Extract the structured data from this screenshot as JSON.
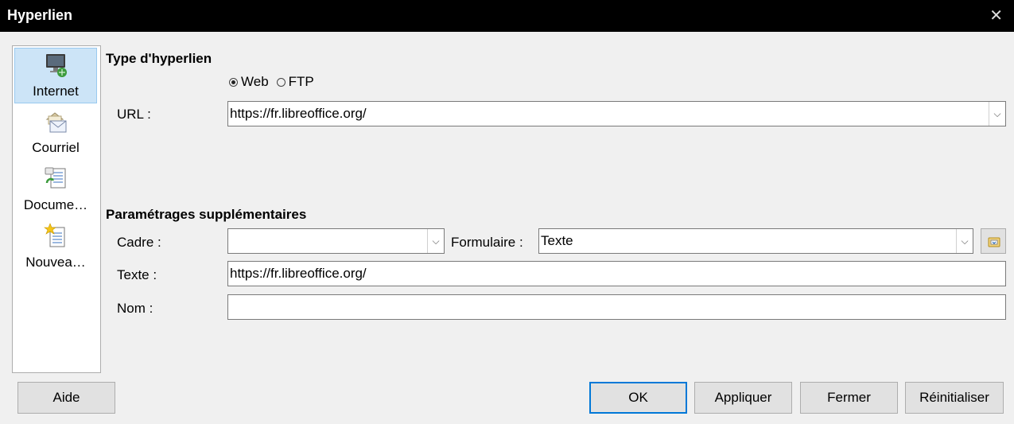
{
  "window": {
    "title": "Hyperlien",
    "close_glyph": "✕"
  },
  "sidebar": {
    "items": [
      {
        "label": "Internet",
        "icon": "internet-icon",
        "selected": true
      },
      {
        "label": "Courriel",
        "icon": "mail-icon"
      },
      {
        "label": "Docume…",
        "icon": "document-icon"
      },
      {
        "label": "Nouvea…",
        "icon": "new-document-icon"
      }
    ]
  },
  "hyperlink_type": {
    "title": "Type d'hyperlien",
    "radio_web": "Web",
    "radio_ftp": "FTP",
    "url_label": "URL :",
    "url_value": "https://fr.libreoffice.org/"
  },
  "extra": {
    "title": "Paramétrages supplémentaires",
    "frame_label": "Cadre :",
    "frame_value": "",
    "form_label": "Formulaire :",
    "form_value": "Texte",
    "text_label": "Texte :",
    "text_value": "https://fr.libreoffice.org/",
    "name_label": "Nom :",
    "name_value": ""
  },
  "buttons": {
    "help": "Aide",
    "ok": "OK",
    "apply": "Appliquer",
    "close": "Fermer",
    "reset": "Réinitialiser"
  }
}
